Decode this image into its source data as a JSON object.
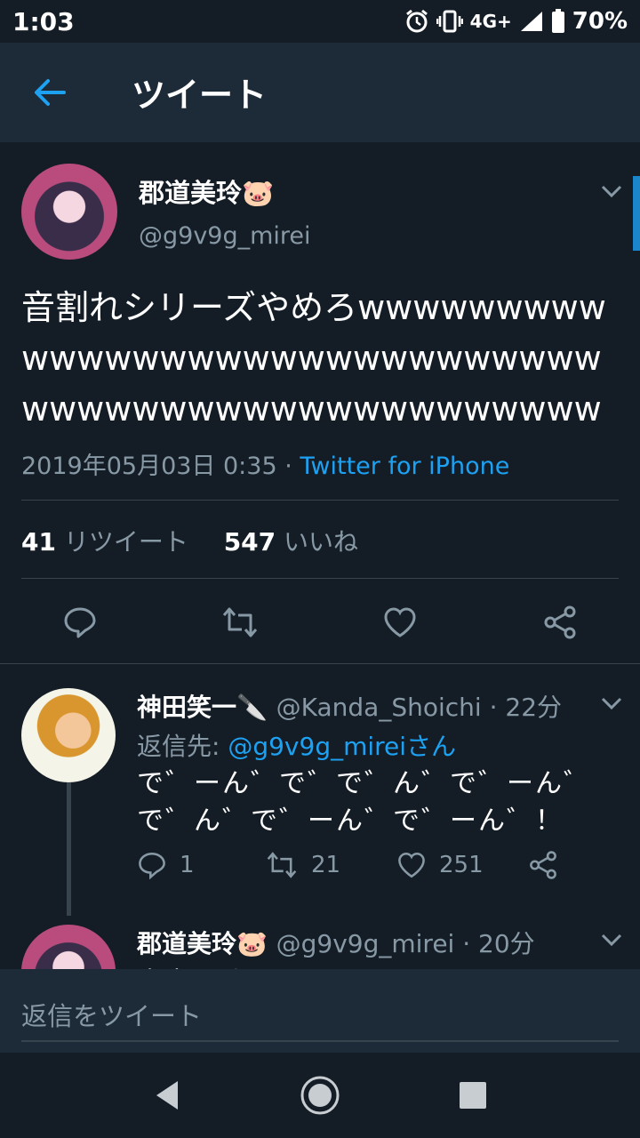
{
  "status": {
    "time": "1:03",
    "network": "4G+",
    "battery": "70%"
  },
  "appbar": {
    "title": "ツイート"
  },
  "tweet": {
    "name": "郡道美玲🐷",
    "handle": "@g9v9g_mirei",
    "text": "音割れシリーズやめろwwwwwwwwwwwwwwwwwwwwwwwwwwwwwwwwwwwwwwwwwwwwwwwwwww",
    "timestamp": "2019年05月03日 0:35 · ",
    "source": "Twitter for iPhone",
    "retweet_count": "41",
    "retweet_label": " リツイート",
    "like_count": "547",
    "like_label": " いいね"
  },
  "reply1": {
    "name": "神田笑一🔪",
    "handle": "@Kanda_Shoichi",
    "time": " · 22分",
    "reply_to_prefix": "返信先: ",
    "reply_to_handle": "@g9v9g_mireiさん",
    "line1": "で゛ーん゛で゛で゛ん゛で゛ーん゛",
    "line2": "で゛ん゛で゛ーん゛で゛ーん゛！",
    "replies": "1",
    "retweets": "21",
    "likes": "251"
  },
  "reply2": {
    "name": "郡道美玲🐷",
    "handle": "@g9v9g_mirei",
    "time": " · 20分",
    "partial_text": "音声は黙って"
  },
  "compose": {
    "placeholder": "返信をツイート"
  },
  "colors": {
    "background": "#141d26",
    "header": "#1d2a38",
    "accent": "#1da1f2",
    "muted": "#8899a6",
    "divider": "#38444d"
  }
}
